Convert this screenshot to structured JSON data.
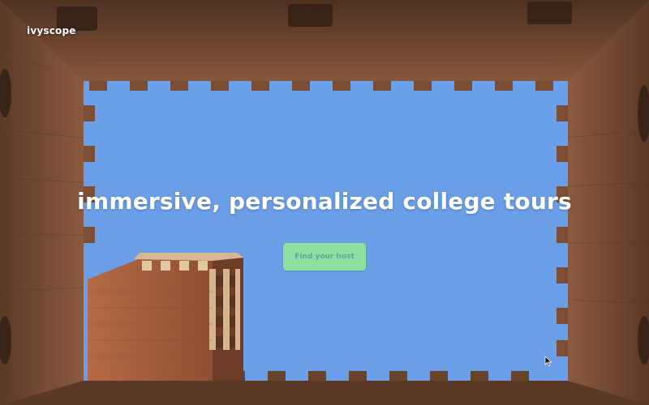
{
  "brand": {
    "name": "ivyscope"
  },
  "hero": {
    "headline": "immersive, personalized college tours",
    "cta_label": "Find your host"
  },
  "colors": {
    "sky": "#6f9fe8",
    "brick": "#8a5a3c",
    "brick_dark": "#5e3b27",
    "cta_bg": "#8ee0a0",
    "cta_text": "#5aa8a0"
  }
}
